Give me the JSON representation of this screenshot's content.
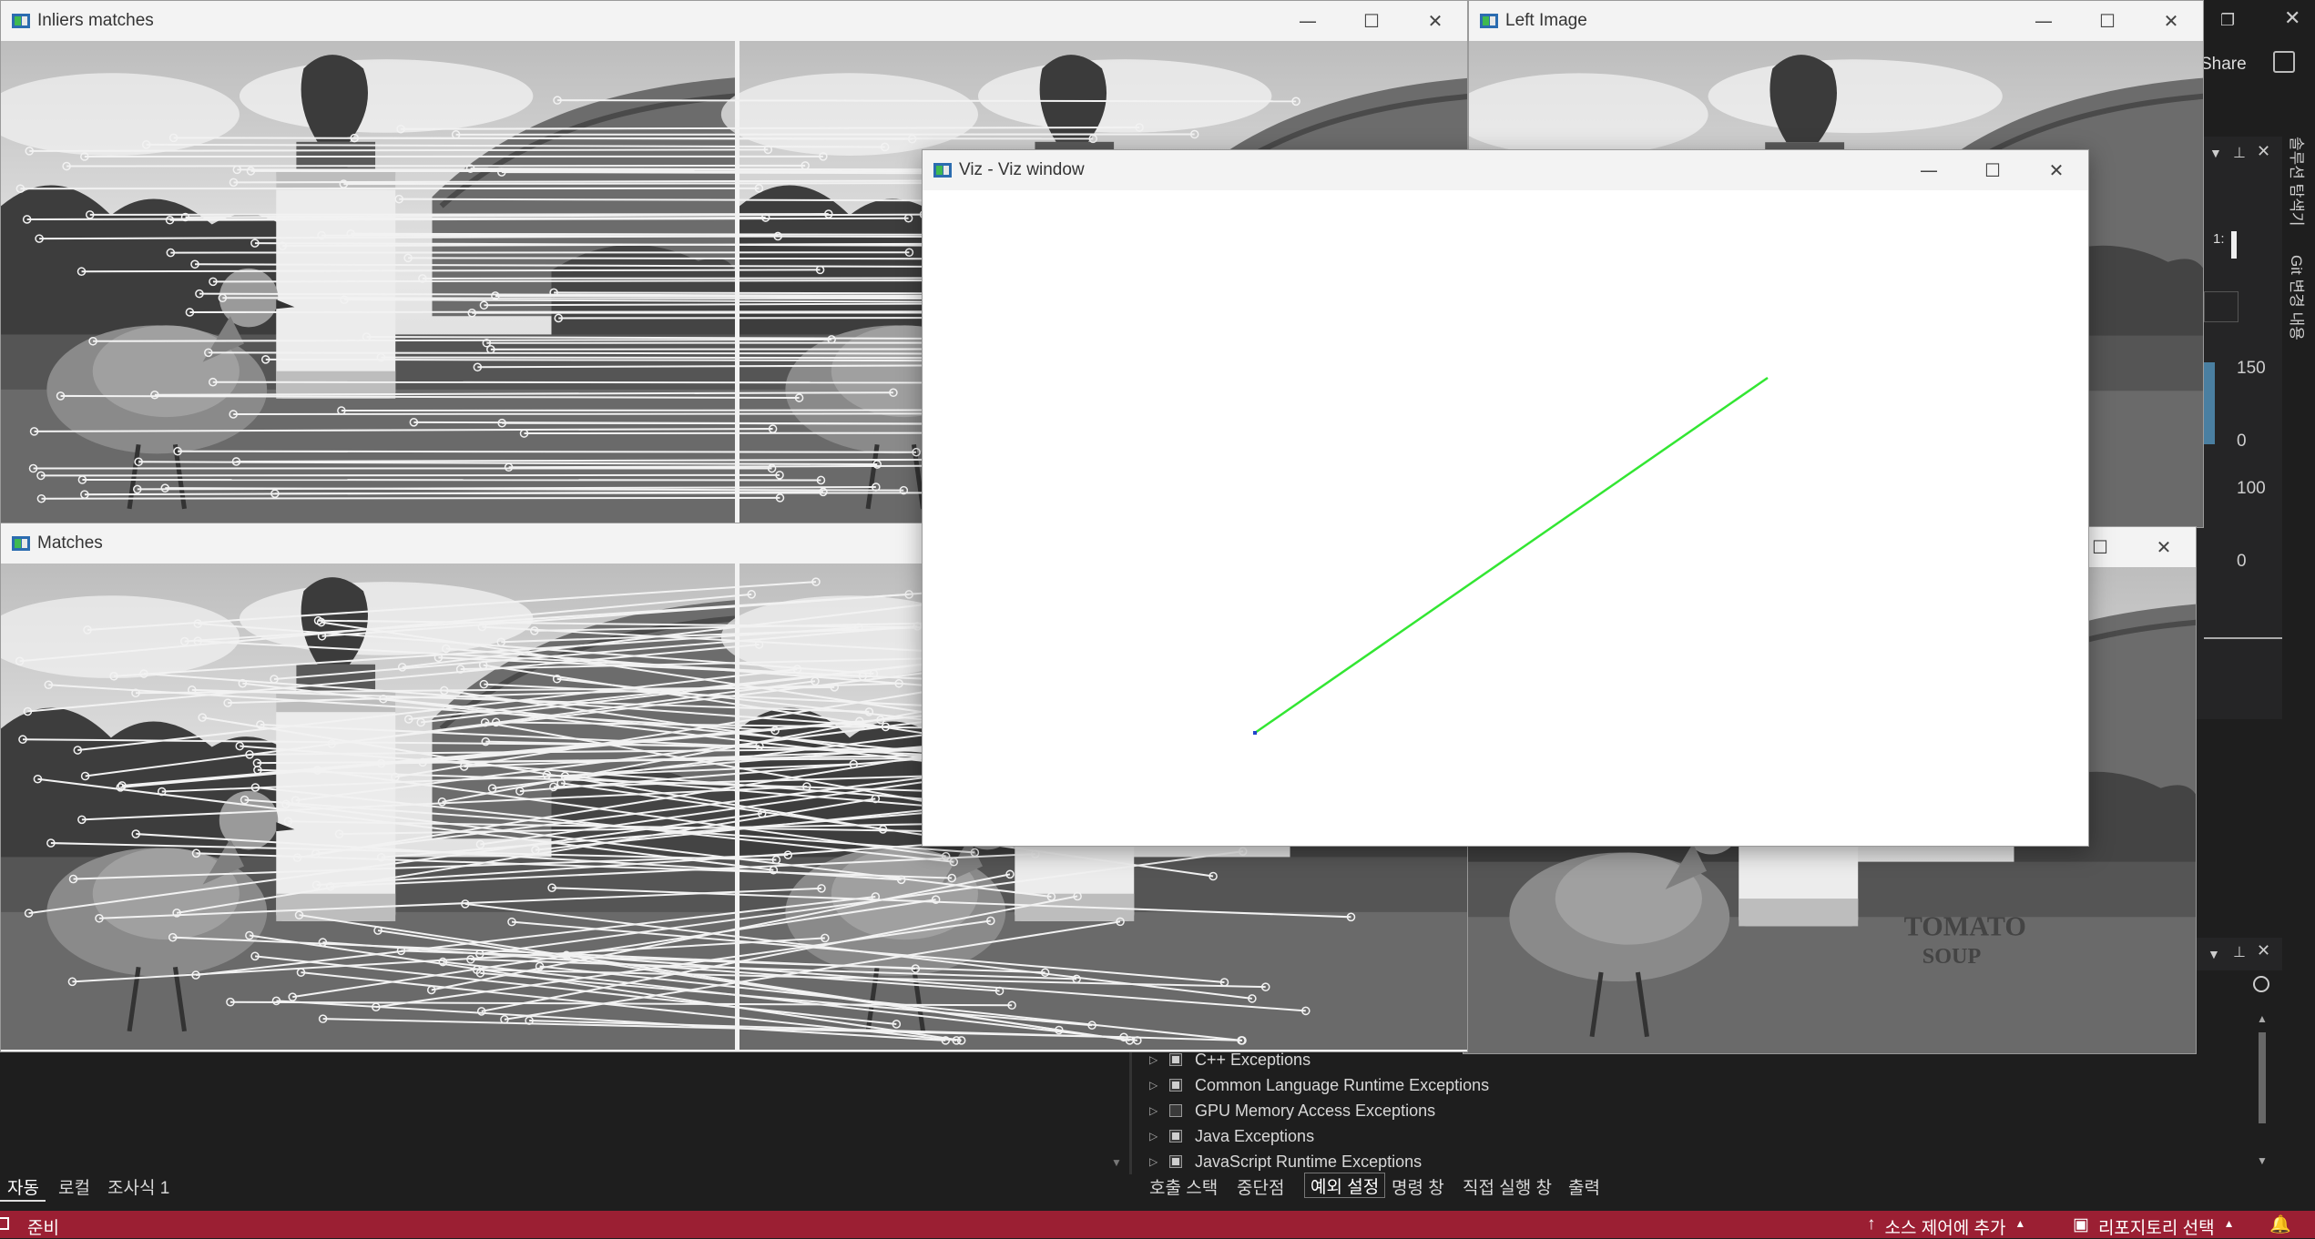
{
  "windows": {
    "inliers": {
      "title": "Inliers matches"
    },
    "left_image": {
      "title": "Left Image"
    },
    "matches": {
      "title": "Matches"
    },
    "viz": {
      "title": "Viz - Viz window"
    }
  },
  "window_buttons": {
    "minimize": "—",
    "maximize": "☐",
    "close": "✕"
  },
  "photo_text": {
    "can_line1": "TOMATO",
    "can_line2": "SOUP"
  },
  "right_panel": {
    "share_label": "Share",
    "vertical_tabs": [
      "솔루션 탐색기",
      "Git 변경 내용"
    ],
    "values": [
      "150",
      "0",
      "100",
      "0"
    ],
    "ratio_label": "1:"
  },
  "exceptions": [
    {
      "label": "C++ Exceptions",
      "checked": true
    },
    {
      "label": "Common Language Runtime Exceptions",
      "checked": true
    },
    {
      "label": "GPU Memory Access Exceptions",
      "checked": false
    },
    {
      "label": "Java Exceptions",
      "checked": true
    },
    {
      "label": "JavaScript Runtime Exceptions",
      "checked": true
    }
  ],
  "bottom_left_tabs": [
    "자동",
    "로컬",
    "조사식 1"
  ],
  "bottom_right_tabs": [
    "호출 스택",
    "중단점",
    "예외 설정",
    "명령 창",
    "직접 실행 창",
    "출력"
  ],
  "statusbar": {
    "ready": "준비",
    "source_control": "소스 제어에 추가",
    "repo": "리포지토리 선택"
  },
  "colors": {
    "accent_status": "#9b1f33",
    "viz_line": "#33e633",
    "vs_background": "#1e1e1e"
  }
}
